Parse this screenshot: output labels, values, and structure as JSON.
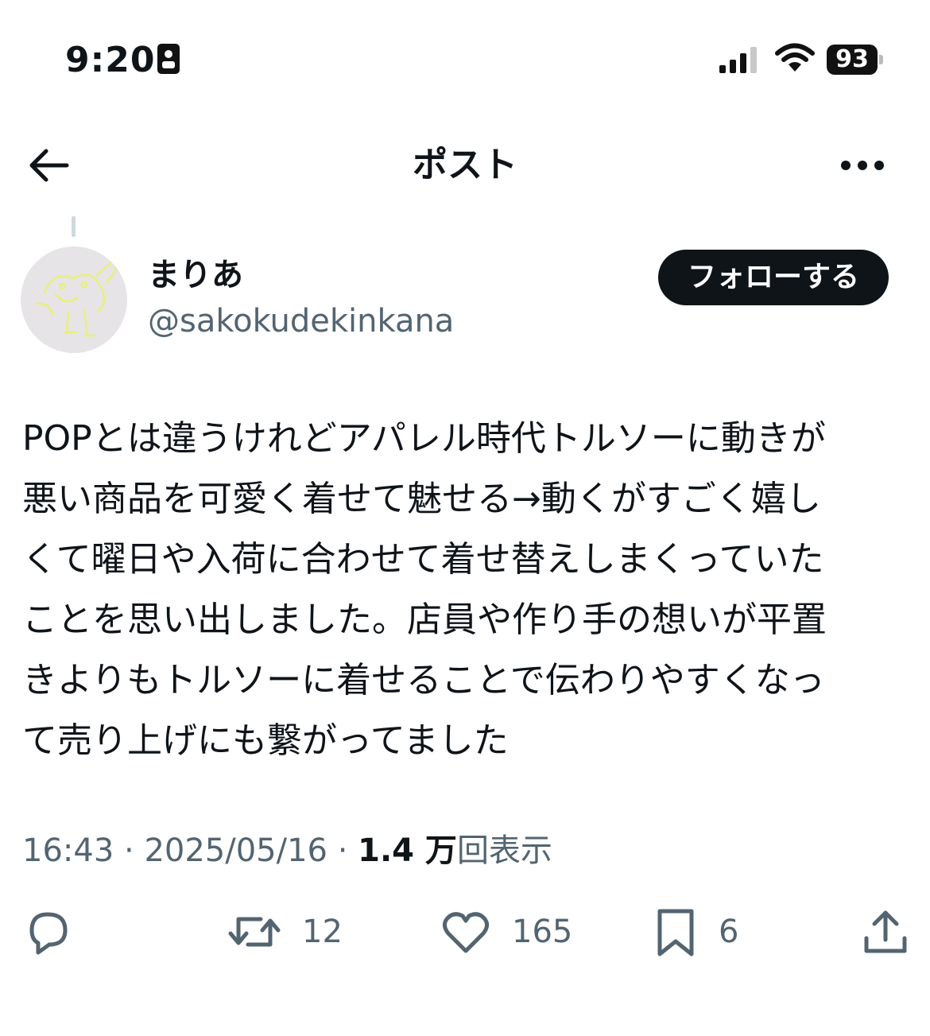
{
  "status_bar": {
    "time": "9:20",
    "battery": "93"
  },
  "header": {
    "title": "ポスト"
  },
  "author": {
    "display_name": "まりあ",
    "username": "@sakokudekinkana",
    "follow_label": "フォローする"
  },
  "post": {
    "text": "POPとは違うけれどアパレル時代トルソーに動きが\n悪い商品を可愛く着せて魅せる→動くがすごく嬉し\nくて曜日や入荷に合わせて着せ替えしまくっていた\nことを思い出しました。店員や作り手の想いが平置\nきよりもトルソーに着せることで伝わりやすくなっ\nて売り上げにも繋がってました"
  },
  "meta": {
    "time": "16:43",
    "separator": " · ",
    "date": "2025/05/16",
    "views_count": "1.4 万",
    "views_label": "回表示"
  },
  "actions": {
    "reposts": "12",
    "likes": "165",
    "bookmarks": "6"
  },
  "colors": {
    "text": "#0f1419",
    "secondary": "#536471",
    "button_bg": "#0f1419",
    "avatar_bg": "#e6e4e6",
    "avatar_doodle": "#e8f07a"
  }
}
